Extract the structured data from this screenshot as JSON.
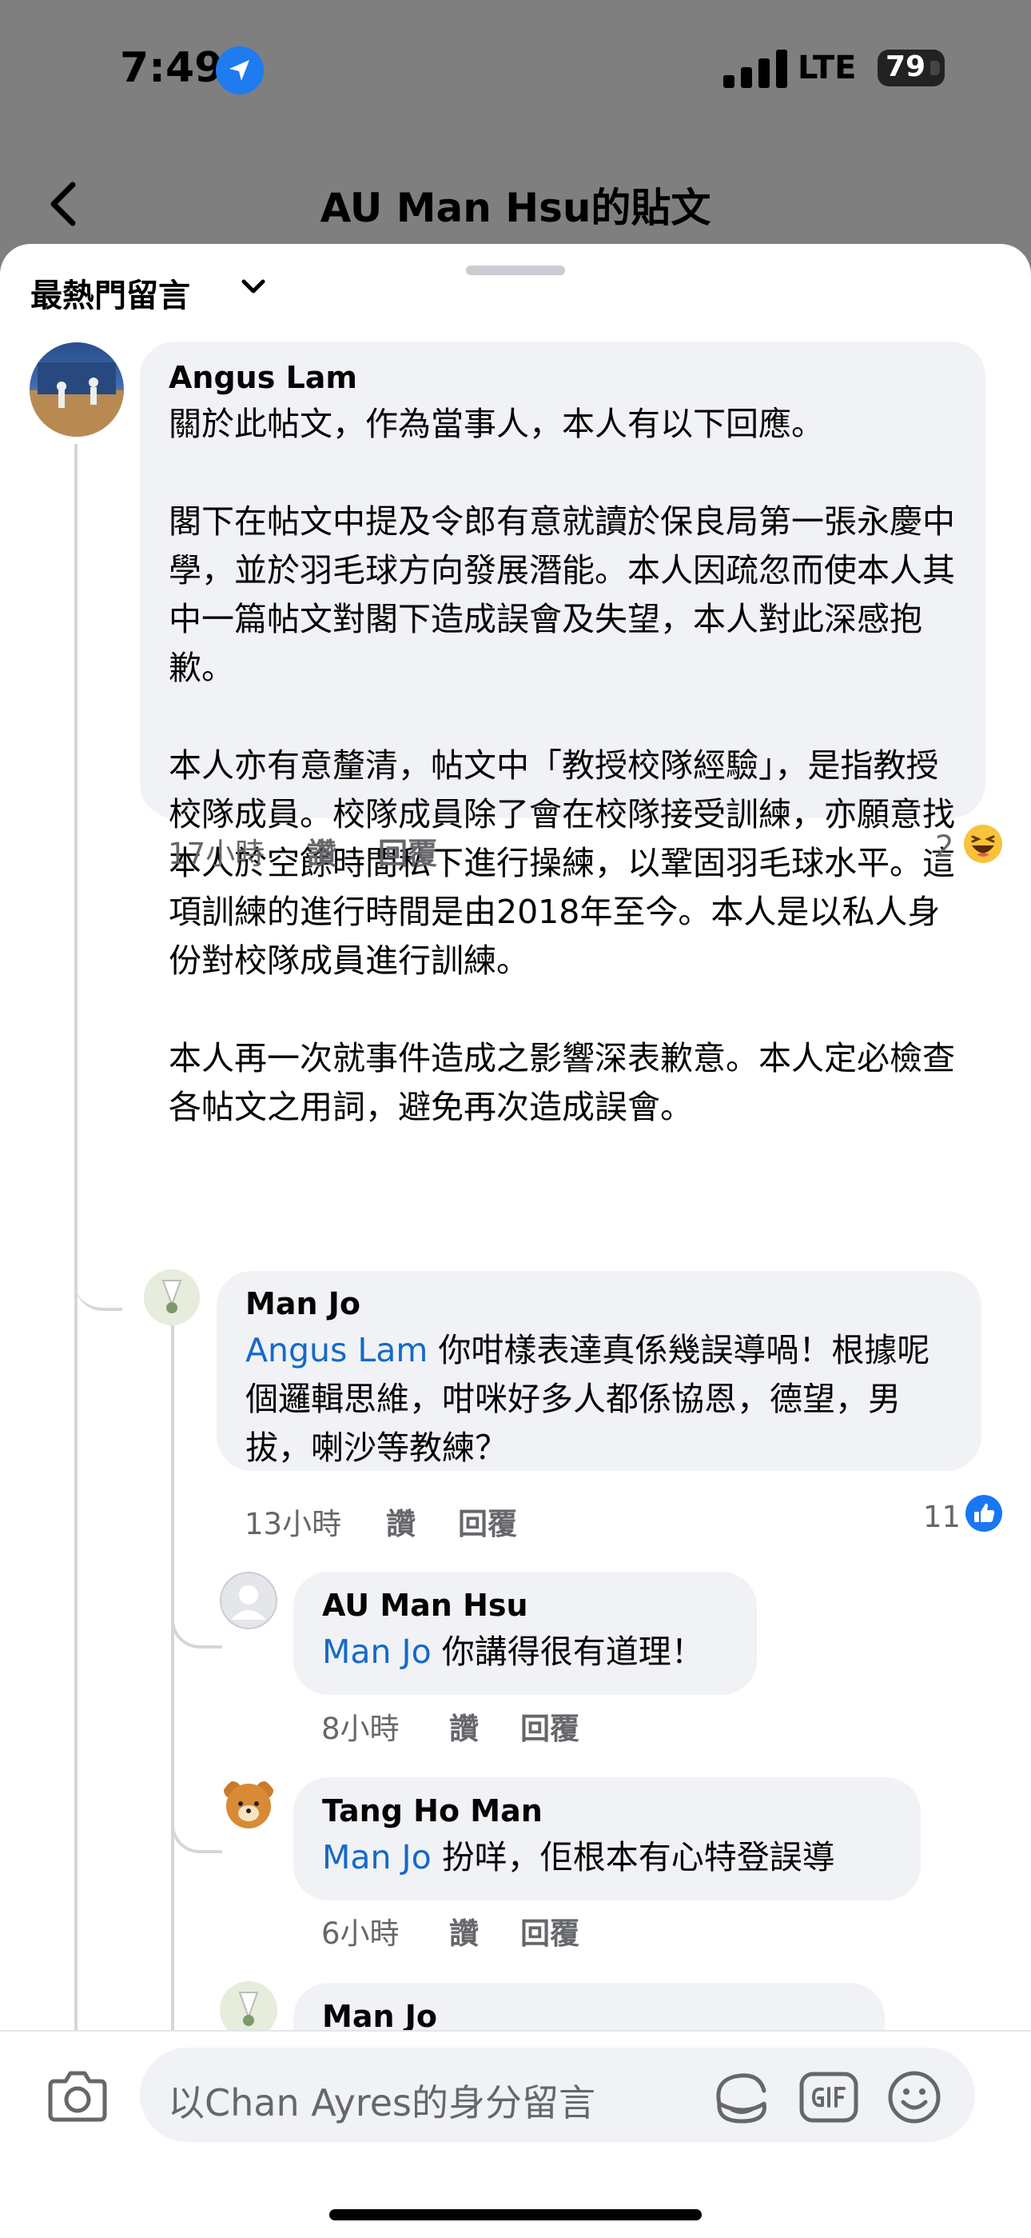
{
  "status_bar": {
    "time": "7:49",
    "network": "LTE",
    "battery": "79"
  },
  "header": {
    "title": "AU Man Hsu的貼文"
  },
  "sort": {
    "label": "最熱門留言"
  },
  "comments": [
    {
      "author": "Angus Lam",
      "text": "關於此帖文，作為當事人，本人有以下回應。\n\n閣下在帖文中提及令郎有意就讀於保良局第一張永慶中學，並於羽毛球方向發展潛能。本人因疏忽而使本人其中一篇帖文對閣下造成誤會及失望，本人對此深感抱歉。\n\n本人亦有意釐清，帖文中「教授校隊經驗」，是指教授校隊成員。校隊成員除了會在校隊接受訓練，亦願意找本人於空餘時間私下進行操練，以鞏固羽毛球水平。這項訓練的進行時間是由2018年至今。本人是以私人身份對校隊成員進行訓練。\n\n本人再一次就事件造成之影響深表歉意。本人定必檢查各帖文之用詞，避免再次造成誤會。",
      "time": "17小時",
      "like": "讚",
      "reply": "回覆",
      "reactions": "2",
      "reaction_icon": "haha-emoji-icon"
    }
  ],
  "replies": [
    {
      "author": "Man Jo",
      "mention": "Angus Lam",
      "text": " 你咁樣表達真係幾誤導喎！根據呢個邏輯思維，咁咪好多人都係協恩，德望，男拔，喇沙等教練？",
      "time": "13小時",
      "like": "讚",
      "reply": "回覆",
      "reactions": "11",
      "reaction_icon": "like-icon"
    },
    {
      "author": "AU Man Hsu",
      "mention": "Man Jo",
      "text": " 你講得很有道理！",
      "time": "8小時",
      "like": "讚",
      "reply": "回覆"
    },
    {
      "author": "Tang Ho Man",
      "mention": "Man Jo",
      "text": " 扮咩，佢根本有心特登誤導",
      "time": "6小時",
      "like": "讚",
      "reply": "回覆"
    },
    {
      "author": "Man Jo"
    }
  ],
  "composer": {
    "placeholder": "以Chan Ayres的身分留言"
  },
  "colors": {
    "accent": "#1669c9",
    "like_blue": "#1877f2",
    "bubble": "#f0f2f5"
  }
}
